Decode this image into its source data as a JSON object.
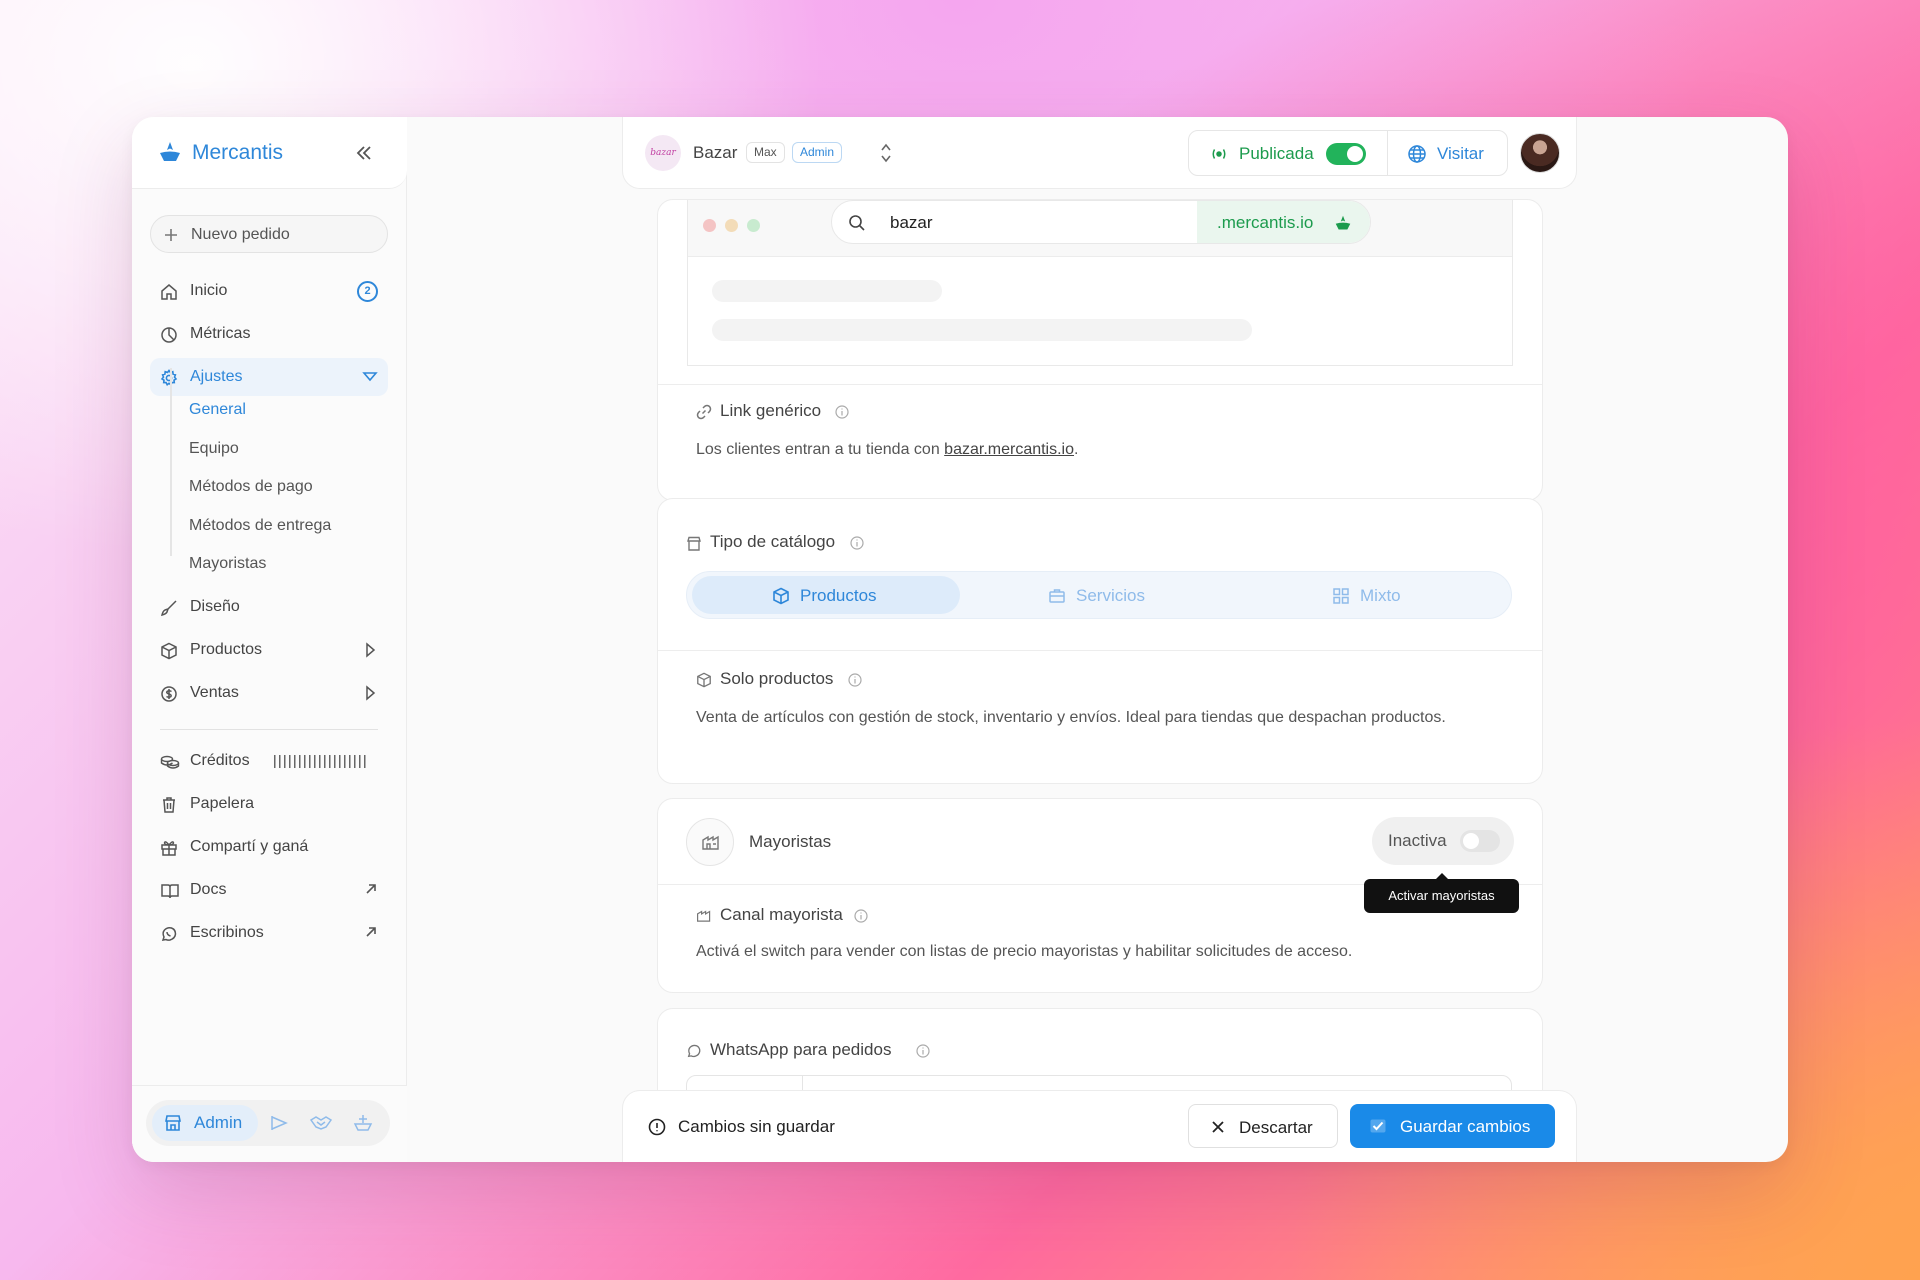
{
  "brand": {
    "name": "Mercantis",
    "accent": "#2e87d9"
  },
  "sidebar": {
    "new_order_label": "Nuevo pedido",
    "items": [
      {
        "label": "Inicio",
        "icon": "home-icon",
        "badge": "2"
      },
      {
        "label": "Métricas",
        "icon": "pie-chart-icon"
      },
      {
        "label": "Ajustes",
        "icon": "gear-icon",
        "active": true
      },
      {
        "label": "Diseño",
        "icon": "brush-icon"
      },
      {
        "label": "Productos",
        "icon": "box-icon"
      },
      {
        "label": "Ventas",
        "icon": "dollar-icon"
      },
      {
        "label": "Créditos",
        "icon": "coins-icon"
      },
      {
        "label": "Papelera",
        "icon": "trash-icon"
      },
      {
        "label": "Compartí y ganá",
        "icon": "gift-icon"
      },
      {
        "label": "Docs",
        "icon": "book-icon"
      },
      {
        "label": "Escribinos",
        "icon": "whatsapp-icon"
      }
    ],
    "subitems": [
      "General",
      "Equipo",
      "Métodos de pago",
      "Métodos de entrega",
      "Mayoristas"
    ],
    "footer": {
      "admin_label": "Admin"
    }
  },
  "topbar": {
    "store_name": "Bazar",
    "store_avatar_text": "bazar",
    "plan_tag": "Max",
    "role_tag": "Admin",
    "published_label": "Publicada",
    "published": true,
    "visit_label": "Visitar"
  },
  "preview": {
    "url_value": "bazar",
    "domain": ".mercantis.io"
  },
  "link_section": {
    "title": "Link genérico",
    "desc_prefix": "Los clientes entran a tu tienda con ",
    "link": "bazar.mercantis.io",
    "desc_suffix": "."
  },
  "catalog": {
    "title": "Tipo de catálogo",
    "options": [
      "Productos",
      "Servicios",
      "Mixto"
    ],
    "selected": "Productos",
    "sub_title": "Solo productos",
    "sub_desc": "Venta de artículos con gestión de stock, inventario y envíos. Ideal para tiendas que despachan productos."
  },
  "wholesale": {
    "title": "Mayoristas",
    "status": "Inactiva",
    "enabled": false,
    "tooltip": "Activar mayoristas",
    "sub_title": "Canal mayorista",
    "sub_desc": "Activá el switch para vender con listas de precio mayoristas y habilitar solicitudes de acceso."
  },
  "whatsapp": {
    "title": "WhatsApp para pedidos"
  },
  "savebar": {
    "message": "Cambios sin guardar",
    "discard_label": "Descartar",
    "save_label": "Guardar cambios"
  }
}
